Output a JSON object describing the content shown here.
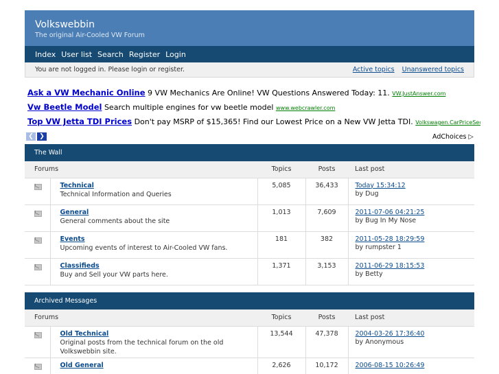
{
  "header": {
    "title": "Volkswebbin",
    "description": "The original Air-Cooled VW Forum"
  },
  "menu": [
    "Index",
    "User list",
    "Search",
    "Register",
    "Login"
  ],
  "status": {
    "welcome": "You are not logged in. Please login or register.",
    "links": [
      "Active topics",
      "Unanswered topics"
    ]
  },
  "ads": [
    {
      "title": "Ask a VW Mechanic Online",
      "text": "9 VW Mechanics Are Online! VW Questions Answered Today: 11.",
      "url": "VW.JustAnswer.com"
    },
    {
      "title": "Vw Beetle Model",
      "text": "Search multiple engines for vw beetle model",
      "url": "www.webcrawler.com"
    },
    {
      "title": "Top VW Jetta TDI Prices",
      "text": "Don't pay MSRP of $15,365! Find our Lowest Price on a New VW Jetta TDI.",
      "url": "Volkswagen.CarPriceSecrets.com"
    }
  ],
  "adchoices": "AdChoices",
  "columns": {
    "forums": "Forums",
    "topics": "Topics",
    "posts": "Posts",
    "last": "Last post"
  },
  "categories": [
    {
      "name": "The Wall",
      "forums": [
        {
          "title": "Technical",
          "desc": "Technical Information and Queries",
          "topics": "5,085",
          "posts": "36,433",
          "last": "Today 15:34:12",
          "by": "by Dug"
        },
        {
          "title": "General",
          "desc": "General comments about the site",
          "topics": "1,013",
          "posts": "7,609",
          "last": "2011-07-06 04:21:25",
          "by": "by Bug In My Nose"
        },
        {
          "title": "Events",
          "desc": "Upcoming events of interest to Air-Cooled VW fans.",
          "topics": "181",
          "posts": "382",
          "last": "2011-05-28 18:29:59",
          "by": "by rumpster 1"
        },
        {
          "title": "Classifieds",
          "desc": "Buy and Sell your VW parts here.",
          "topics": "1,371",
          "posts": "3,153",
          "last": "2011-06-29 18:15:53",
          "by": "by Betty"
        }
      ]
    },
    {
      "name": "Archived Messages",
      "forums": [
        {
          "title": "Old Technical",
          "desc": "Original posts from the technical forum on the old Volkswebbin site.",
          "topics": "13,544",
          "posts": "47,378",
          "last": "2004-03-26 17:36:40",
          "by": "by Anonymous"
        },
        {
          "title": "Old General",
          "desc": "",
          "topics": "2,626",
          "posts": "10,172",
          "last": "2006-08-15 10:26:49",
          "by": ""
        }
      ]
    }
  ]
}
